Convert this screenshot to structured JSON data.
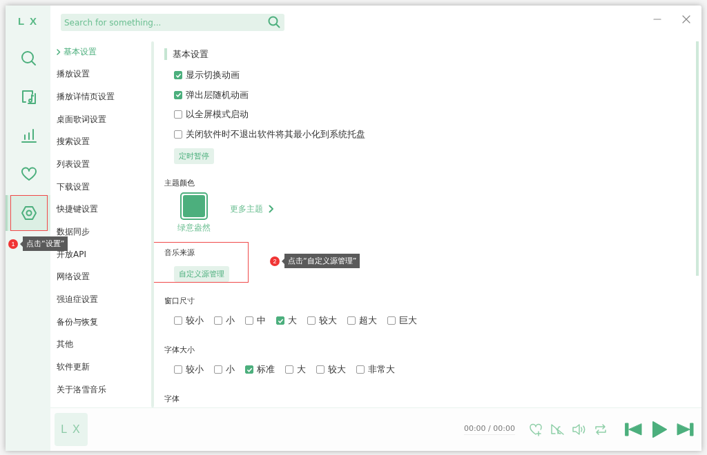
{
  "app": {
    "logo": "L X"
  },
  "nav": [
    {
      "kind": "search",
      "selected": false
    },
    {
      "kind": "music",
      "selected": false
    },
    {
      "kind": "chart",
      "selected": false
    },
    {
      "kind": "heart",
      "selected": false
    },
    {
      "kind": "settings",
      "selected": true,
      "highlighted": true,
      "annotation": {
        "number": "1",
        "text": "点击“设置”"
      }
    }
  ],
  "search": {
    "placeholder": "Search for something..."
  },
  "settings_nav": [
    {
      "label": "基本设置",
      "selected": true
    },
    {
      "label": "播放设置",
      "selected": false
    },
    {
      "label": "播放详情页设置",
      "selected": false
    },
    {
      "label": "桌面歌词设置",
      "selected": false
    },
    {
      "label": "搜索设置",
      "selected": false
    },
    {
      "label": "列表设置",
      "selected": false
    },
    {
      "label": "下载设置",
      "selected": false
    },
    {
      "label": "快捷键设置",
      "selected": false
    },
    {
      "label": "数据同步",
      "selected": false
    },
    {
      "label": "开放API",
      "selected": false
    },
    {
      "label": "网络设置",
      "selected": false
    },
    {
      "label": "强迫症设置",
      "selected": false
    },
    {
      "label": "备份与恢复",
      "selected": false
    },
    {
      "label": "其他",
      "selected": false
    },
    {
      "label": "软件更新",
      "selected": false
    },
    {
      "label": "关于洛雪音乐",
      "selected": false
    }
  ],
  "content": [
    {
      "kind": "heading",
      "title": "基本设置",
      "items": [
        {
          "kind": "checkbox",
          "label": "显示切换动画",
          "checked": true
        },
        {
          "kind": "checkbox",
          "label": "弹出层随机动画",
          "checked": true
        },
        {
          "kind": "checkbox",
          "label": "以全屏模式启动",
          "checked": false
        },
        {
          "kind": "checkbox",
          "label": "关闭软件时不退出软件将其最小化到系统托盘",
          "checked": false
        },
        {
          "kind": "button",
          "label": "定时暂停"
        }
      ]
    },
    {
      "kind": "section",
      "title": "主题颜色",
      "items": [
        {
          "kind": "theme",
          "name": "绿意盎然",
          "color": "#4caf7d",
          "selected": true,
          "more": "更多主题"
        }
      ]
    },
    {
      "kind": "section",
      "title": "音乐来源",
      "highlighted": true,
      "annotation": {
        "number": "2",
        "text": "点击“自定义源管理”"
      },
      "items": [
        {
          "kind": "button",
          "label": "自定义源管理"
        }
      ]
    },
    {
      "kind": "section",
      "title": "窗口尺寸",
      "items": [
        {
          "kind": "options",
          "options": [
            {
              "label": "较小",
              "checked": false
            },
            {
              "label": "小",
              "checked": false
            },
            {
              "label": "中",
              "checked": false
            },
            {
              "label": "大",
              "checked": true
            },
            {
              "label": "较大",
              "checked": false
            },
            {
              "label": "超大",
              "checked": false
            },
            {
              "label": "巨大",
              "checked": false
            }
          ]
        }
      ]
    },
    {
      "kind": "section",
      "title": "字体大小",
      "items": [
        {
          "kind": "options",
          "options": [
            {
              "label": "较小",
              "checked": false
            },
            {
              "label": "小",
              "checked": false
            },
            {
              "label": "标准",
              "checked": true
            },
            {
              "label": "大",
              "checked": false
            },
            {
              "label": "较大",
              "checked": false
            },
            {
              "label": "非常大",
              "checked": false
            }
          ]
        }
      ]
    },
    {
      "kind": "section",
      "title": "字体"
    }
  ],
  "player": {
    "logo": "L X",
    "time": "00:00 / 00:00"
  }
}
